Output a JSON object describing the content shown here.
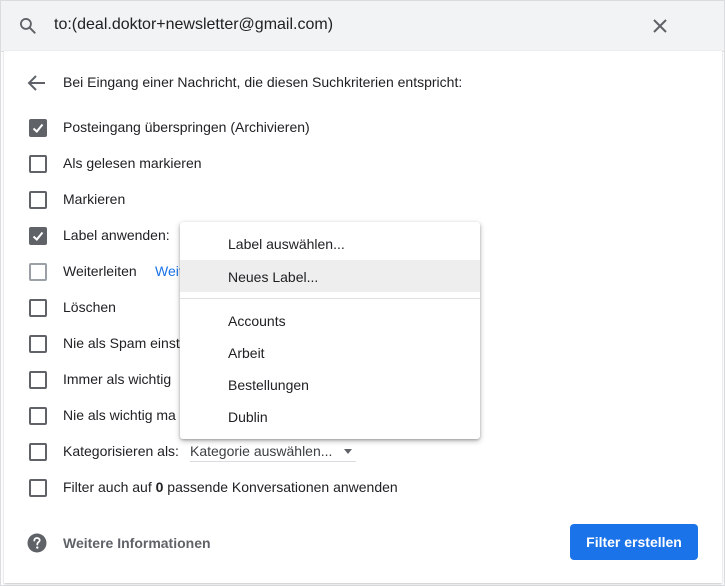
{
  "search": {
    "query": "to:(deal.doktor+newsletter@gmail.com)"
  },
  "header": {
    "criteria_text": "Bei Eingang einer Nachricht, die diesen Suchkriterien entspricht:"
  },
  "actions": [
    {
      "label": "Posteingang überspringen (Archivieren)",
      "checked": true
    },
    {
      "label": "Als gelesen markieren",
      "checked": false
    },
    {
      "label": "Markieren",
      "checked": false
    },
    {
      "label": "Label anwenden:",
      "checked": true
    },
    {
      "label": "Weiterleiten",
      "checked": false
    },
    {
      "label": "Löschen",
      "checked": false
    },
    {
      "label": "Nie als Spam einst",
      "checked": false
    },
    {
      "label": "Immer als wichtig",
      "checked": false
    },
    {
      "label": "Nie als wichtig ma",
      "checked": false
    },
    {
      "label": "Kategorisieren als:",
      "checked": false
    }
  ],
  "forward_link": "Weit",
  "category_select": {
    "value": "Kategorie auswählen..."
  },
  "apply_existing": {
    "prefix": "Filter auch auf ",
    "count": "0",
    "suffix": " passende Konversationen anwenden"
  },
  "footer": {
    "help_label": "Weitere Informationen",
    "create_label": "Filter erstellen"
  },
  "label_menu": {
    "items": [
      {
        "label": "Label auswählen..."
      },
      {
        "label": "Neues Label..."
      }
    ],
    "labels": [
      {
        "label": "Accounts"
      },
      {
        "label": "Arbeit"
      },
      {
        "label": "Bestellungen"
      },
      {
        "label": "Dublin"
      }
    ]
  },
  "colors": {
    "primary": "#1a73e8",
    "checkbox": "#5f6368",
    "search_bg": "#f1f3f4"
  }
}
